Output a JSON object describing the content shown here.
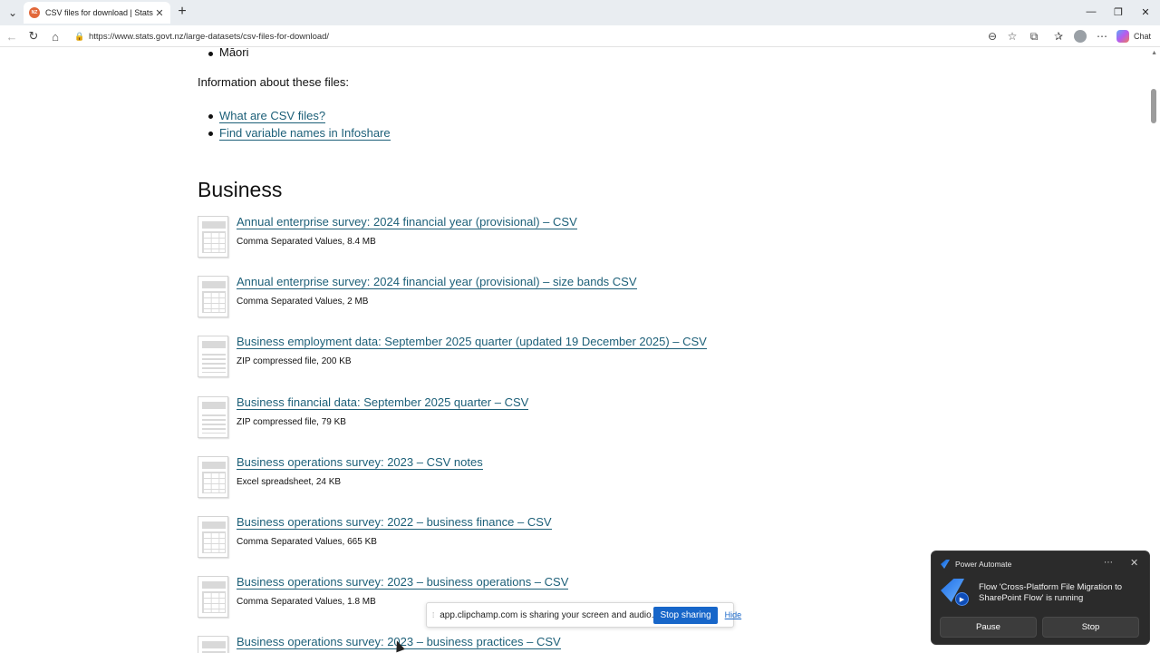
{
  "browser": {
    "tab": {
      "favicon_text": "NZ",
      "title": "CSV files for download | Stats NZ"
    },
    "url": "https://www.stats.govt.nz/large-datasets/csv-files-for-download/",
    "chat_label": "Chat"
  },
  "page": {
    "list_tail": "Māori",
    "info_heading": "Information about these files:",
    "info_links": [
      "What are CSV files?",
      "Find variable names in Infoshare"
    ],
    "section_title": "Business",
    "items": [
      {
        "title": "Annual enterprise survey: 2024 financial year (provisional) – CSV",
        "meta": "Comma Separated Values, 8.4 MB",
        "icon": "spreadsheet-icon"
      },
      {
        "title": "Annual enterprise survey: 2024 financial year (provisional) – size bands CSV",
        "meta": "Comma Separated Values, 2 MB",
        "icon": "spreadsheet-icon"
      },
      {
        "title": "Business employment data: September 2025 quarter (updated 19 December 2025) – CSV",
        "meta": "ZIP compressed file, 200 KB",
        "icon": "document-icon"
      },
      {
        "title": "Business financial data: September 2025 quarter – CSV",
        "meta": "ZIP compressed file, 79 KB",
        "icon": "document-icon"
      },
      {
        "title": "Business operations survey: 2023 – CSV notes",
        "meta": "Excel spreadsheet, 24 KB",
        "icon": "spreadsheet-icon"
      },
      {
        "title": "Business operations survey: 2022 – business finance – CSV",
        "meta": "Comma Separated Values, 665 KB",
        "icon": "spreadsheet-icon"
      },
      {
        "title": "Business operations survey: 2023 – business operations – CSV",
        "meta": "Comma Separated Values, 1.8 MB",
        "icon": "spreadsheet-icon"
      },
      {
        "title": "Business operations survey: 2023 – business practices – CSV",
        "meta": "",
        "icon": "spreadsheet-icon"
      }
    ]
  },
  "sharebar": {
    "text": "app.clipchamp.com is sharing your screen and audio.",
    "stop_label": "Stop sharing",
    "hide_label": "Hide"
  },
  "toast": {
    "app": "Power Automate",
    "message": "Flow 'Cross-Platform File Migration to SharePoint Flow' is running",
    "pause_label": "Pause",
    "stop_label": "Stop"
  }
}
